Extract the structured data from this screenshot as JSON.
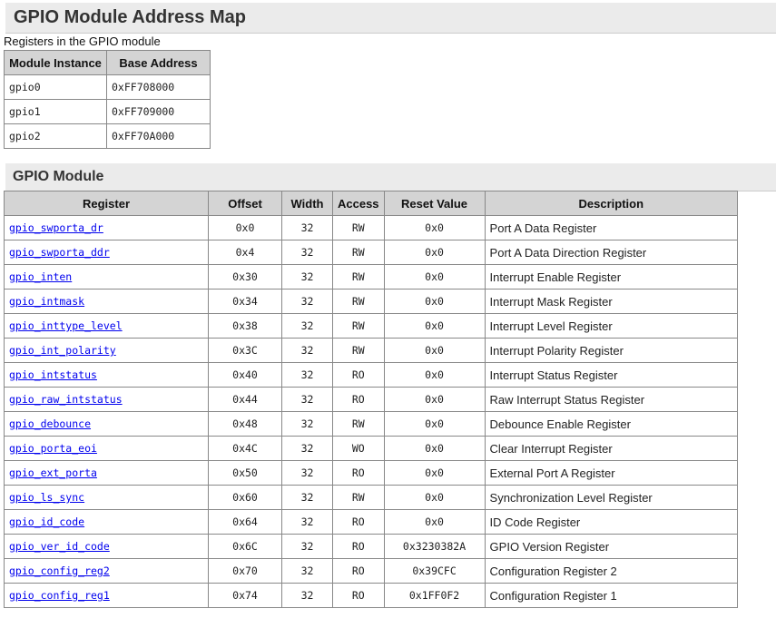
{
  "title": "GPIO Module Address Map",
  "subtitle": "Registers in the GPIO module",
  "instances": {
    "headers": [
      "Module Instance",
      "Base Address"
    ],
    "rows": [
      [
        "gpio0",
        "0xFF708000"
      ],
      [
        "gpio1",
        "0xFF709000"
      ],
      [
        "gpio2",
        "0xFF70A000"
      ]
    ]
  },
  "module": {
    "title": "GPIO Module",
    "headers": [
      "Register",
      "Offset",
      "Width",
      "Access",
      "Reset Value",
      "Description"
    ],
    "rows": [
      [
        "gpio_swporta_dr",
        "0x0",
        "32",
        "RW",
        "0x0",
        "Port A Data Register"
      ],
      [
        "gpio_swporta_ddr",
        "0x4",
        "32",
        "RW",
        "0x0",
        "Port A Data Direction Register"
      ],
      [
        "gpio_inten",
        "0x30",
        "32",
        "RW",
        "0x0",
        "Interrupt Enable Register"
      ],
      [
        "gpio_intmask",
        "0x34",
        "32",
        "RW",
        "0x0",
        "Interrupt Mask Register"
      ],
      [
        "gpio_inttype_level",
        "0x38",
        "32",
        "RW",
        "0x0",
        "Interrupt Level Register"
      ],
      [
        "gpio_int_polarity",
        "0x3C",
        "32",
        "RW",
        "0x0",
        "Interrupt Polarity Register"
      ],
      [
        "gpio_intstatus",
        "0x40",
        "32",
        "RO",
        "0x0",
        "Interrupt Status Register"
      ],
      [
        "gpio_raw_intstatus",
        "0x44",
        "32",
        "RO",
        "0x0",
        "Raw Interrupt Status Register"
      ],
      [
        "gpio_debounce",
        "0x48",
        "32",
        "RW",
        "0x0",
        "Debounce Enable Register"
      ],
      [
        "gpio_porta_eoi",
        "0x4C",
        "32",
        "WO",
        "0x0",
        "Clear Interrupt Register"
      ],
      [
        "gpio_ext_porta",
        "0x50",
        "32",
        "RO",
        "0x0",
        "External Port A Register"
      ],
      [
        "gpio_ls_sync",
        "0x60",
        "32",
        "RW",
        "0x0",
        "Synchronization Level Register"
      ],
      [
        "gpio_id_code",
        "0x64",
        "32",
        "RO",
        "0x0",
        "ID Code Register"
      ],
      [
        "gpio_ver_id_code",
        "0x6C",
        "32",
        "RO",
        "0x3230382A",
        "GPIO Version Register"
      ],
      [
        "gpio_config_reg2",
        "0x70",
        "32",
        "RO",
        "0x39CFC",
        "Configuration Register 2"
      ],
      [
        "gpio_config_reg1",
        "0x74",
        "32",
        "RO",
        "0x1FF0F2",
        "Configuration Register 1"
      ]
    ]
  }
}
